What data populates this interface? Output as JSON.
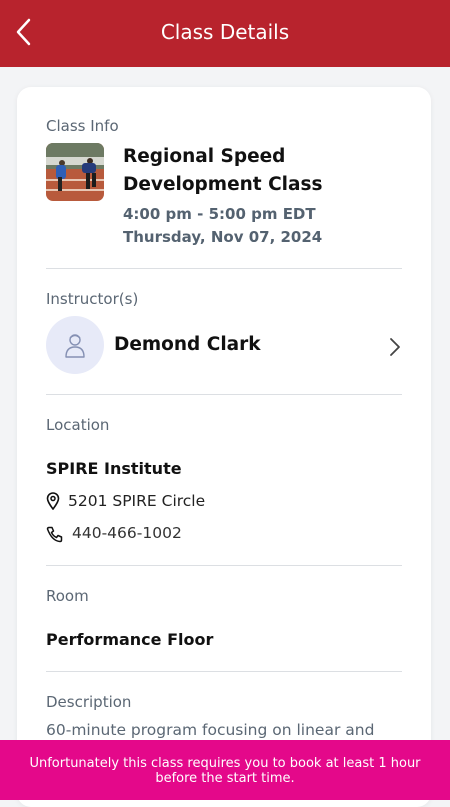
{
  "header": {
    "title": "Class Details"
  },
  "class_info": {
    "section_label": "Class Info",
    "title": "Regional Speed Development Class",
    "time": "4:00 pm - 5:00 pm EDT",
    "date": "Thursday, Nov 07, 2024"
  },
  "instructor": {
    "section_label": "Instructor(s)",
    "name": "Demond Clark"
  },
  "location": {
    "section_label": "Location",
    "name": "SPIRE Institute",
    "address": "5201 SPIRE Circle",
    "phone": "440-466-1002"
  },
  "room": {
    "section_label": "Room",
    "name": "Performance Floor"
  },
  "description": {
    "section_label": "Description",
    "text": "60-minute program focusing on linear and"
  },
  "banner": {
    "message": "Unfortunately this class requires you to book at least 1 hour before the start time."
  },
  "colors": {
    "header": "#b8232d",
    "banner": "#e4088a",
    "avatar_bg": "#e7eaf8"
  }
}
